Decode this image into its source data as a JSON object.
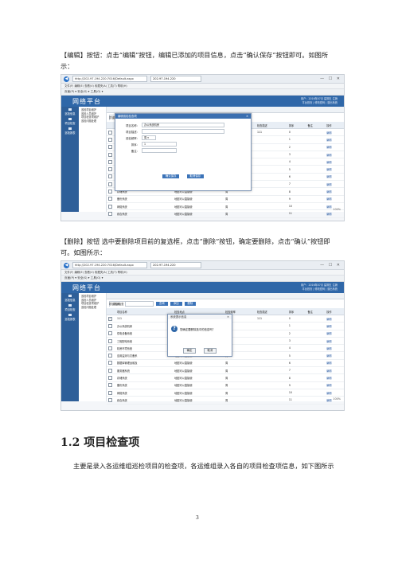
{
  "doc": {
    "edit_para": "【编辑】按钮：点击“编辑”按钮，编辑已添加的项目信息，点击“确认保存”按钮即可。如图所示：",
    "delete_para": "【删除】按钮 选中要删除项目前的复选框，点击“删除”按钮，确定要删除，点击“确认”按钮即可。如图所示：",
    "section_heading": "1.2 项目检查项",
    "section_para": "主要是录入各运维组巡检项目的检查项，各运维组录入各自的项目检查项信息，如下图所示",
    "page_number": "3"
  },
  "shot": {
    "address": "http://202.97.194.220:7016/Default.aspx",
    "tab_label": "202.97.194.220",
    "window_controls": "— ☐ ✕",
    "menu": "文件(F)  编辑(E)  查看(V)  收藏夹(A)  工具(T)  帮助(H)",
    "toolbar": "页面(P) ▾  安全(S) ▾  工具(O) ▾",
    "app_title": "网络平台",
    "user_info": "用户：2016年07月 星期五  注销",
    "user_links": "平台首页 | 修改密码 | 退出系统",
    "sidebar": [
      "巡检信息",
      "项目检查",
      "巡检报表"
    ],
    "tree": [
      "巡检项目维护",
      "巡检人员维护",
      "项目检查项维护",
      "巡检问题处理"
    ],
    "open_tab": "项目检查",
    "search_label": "项目名称：",
    "buttons": {
      "query": "查询",
      "add": "添加",
      "delete": "删除"
    },
    "columns": [
      "项目名称",
      "检查地点",
      "检查频率",
      "检查描述",
      "排序",
      "备注",
      "操作"
    ],
    "rows": [
      {
        "name": "111",
        "place": "地图可以直接使",
        "freq": "日",
        "desc": "111",
        "sort": "0",
        "op": "编辑"
      },
      {
        "name": "办公系统机房",
        "place": "地图可以直接使",
        "freq": "周",
        "desc": "",
        "sort": "1",
        "op": "编辑"
      },
      {
        "name": "供电设备系统",
        "place": "地图可以直接使",
        "freq": "周",
        "desc": "",
        "sort": "2",
        "op": "编辑"
      },
      {
        "name": "三相配电系统",
        "place": "地图可以直接使",
        "freq": "周",
        "desc": "",
        "sort": "3",
        "op": "编辑"
      },
      {
        "name": "机房环境系统",
        "place": "地图可以直接使",
        "freq": "周",
        "desc": "",
        "sort": "4",
        "op": "编辑"
      },
      {
        "name": "应用监测与灾备系",
        "place": "地图可以直接使",
        "freq": "周",
        "desc": "",
        "sort": "5",
        "op": "编辑"
      },
      {
        "name": "数据库管理运维及",
        "place": "地图可以直接使",
        "freq": "周",
        "desc": "",
        "sort": "6",
        "op": "编辑"
      },
      {
        "name": "服务器系统",
        "place": "地图可以直接使",
        "freq": "周",
        "desc": "",
        "sort": "7",
        "op": "编辑"
      },
      {
        "name": "存储系统",
        "place": "地图可以直接使",
        "freq": "周",
        "desc": "",
        "sort": "8",
        "op": "编辑"
      },
      {
        "name": "备份系统",
        "place": "地图可以直接使",
        "freq": "周",
        "desc": "",
        "sort": "9",
        "op": "编辑"
      },
      {
        "name": "网络系统",
        "place": "地图可以直接使",
        "freq": "周",
        "desc": "",
        "sort": "10",
        "op": "编辑"
      },
      {
        "name": "综合系统",
        "place": "地图可以直接使",
        "freq": "周",
        "desc": "",
        "sort": "11",
        "op": "编辑"
      }
    ],
    "edit_modal": {
      "title": "编辑巡检检查项",
      "name_label": "项目名称：",
      "name_value": "办公系统机房",
      "place_label": "项目描述：",
      "freq_label": "巡检频率：",
      "freq_value": "周 ▾",
      "sort_label": "排序：",
      "sort_value": "1",
      "remark_label": "备注：",
      "save": "确认保存",
      "cancel": "取消保存"
    },
    "confirm_modal": {
      "title": "系统提示信息",
      "message": "您确定要删除选中的信息吗？",
      "ok": "确定",
      "cancel": "取消"
    },
    "zoom": "100%"
  }
}
